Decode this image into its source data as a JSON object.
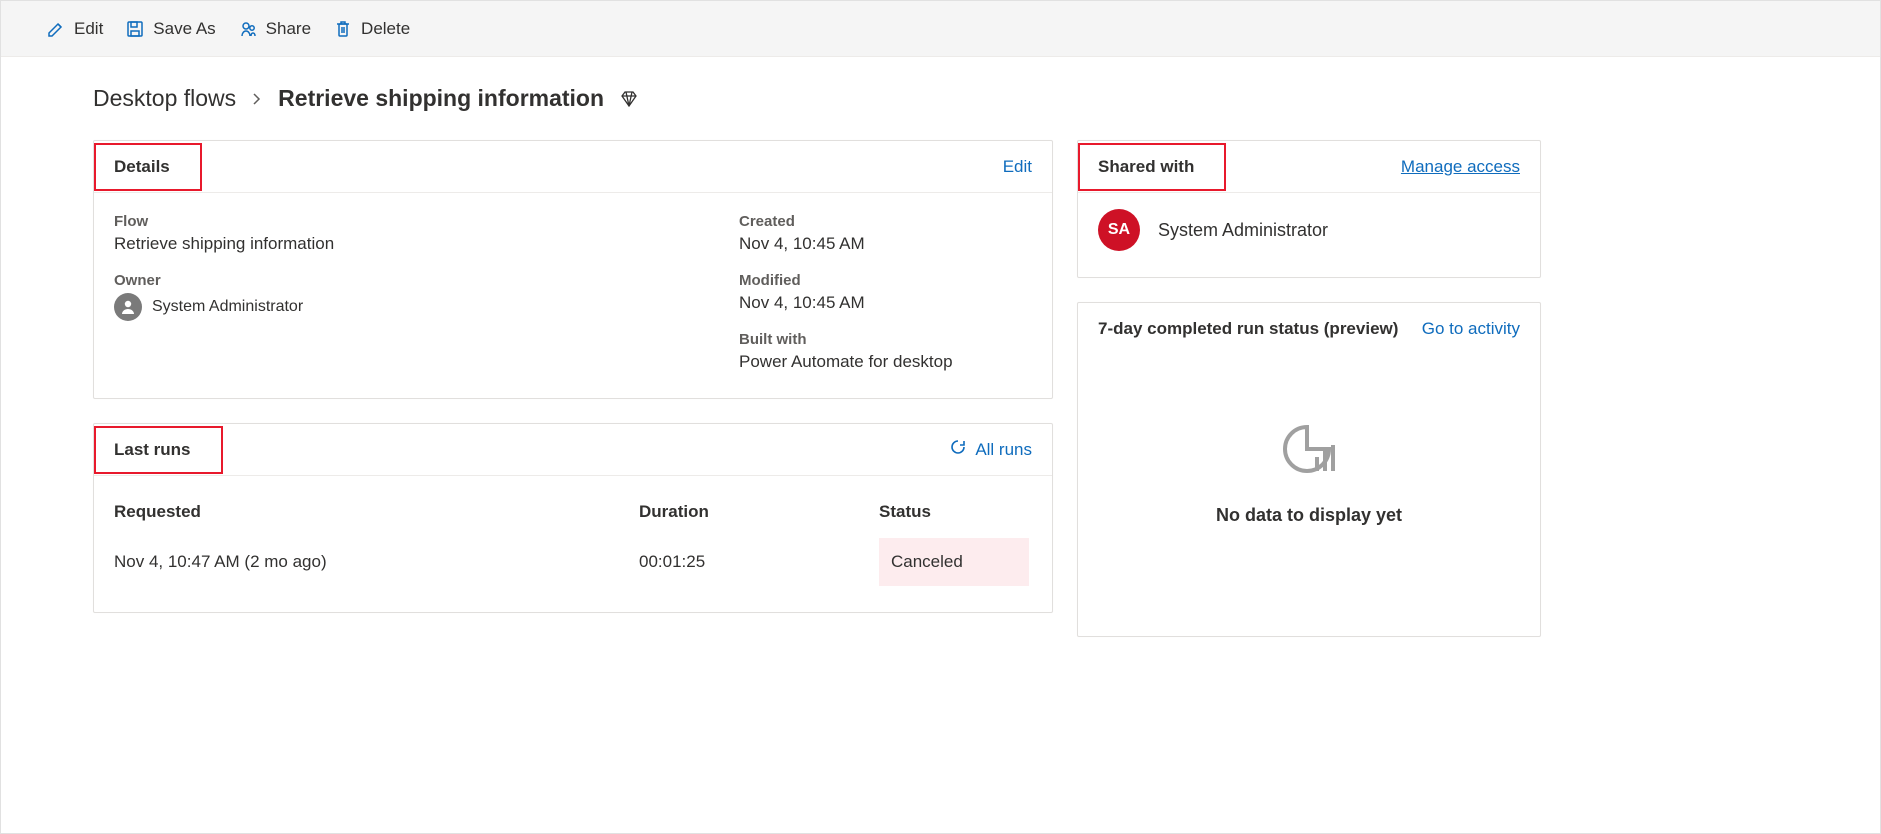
{
  "toolbar": {
    "edit": "Edit",
    "saveAs": "Save As",
    "share": "Share",
    "delete": "Delete"
  },
  "breadcrumb": {
    "root": "Desktop flows",
    "current": "Retrieve shipping information"
  },
  "details": {
    "title": "Details",
    "editLink": "Edit",
    "flowLabel": "Flow",
    "flowValue": "Retrieve shipping information",
    "ownerLabel": "Owner",
    "ownerName": "System Administrator",
    "createdLabel": "Created",
    "createdValue": "Nov 4, 10:45 AM",
    "modifiedLabel": "Modified",
    "modifiedValue": "Nov 4, 10:45 AM",
    "builtWithLabel": "Built with",
    "builtWithValue": "Power Automate for desktop"
  },
  "lastRuns": {
    "title": "Last runs",
    "allRuns": "All runs",
    "headers": {
      "requested": "Requested",
      "duration": "Duration",
      "status": "Status"
    },
    "rows": [
      {
        "requested": "Nov 4, 10:47 AM (2 mo ago)",
        "duration": "00:01:25",
        "status": "Canceled"
      }
    ]
  },
  "sharedWith": {
    "title": "Shared with",
    "manageLink": "Manage access",
    "entries": [
      {
        "initials": "SA",
        "name": "System Administrator"
      }
    ]
  },
  "runStatus": {
    "title": "7-day completed run status (preview)",
    "goToActivity": "Go to activity",
    "noData": "No data to display yet"
  }
}
